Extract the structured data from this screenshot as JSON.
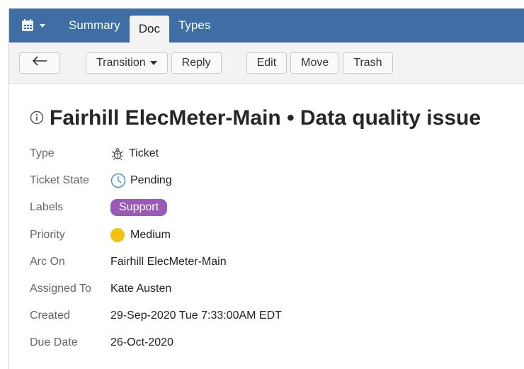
{
  "nav": {
    "tabs": [
      {
        "label": "Summary",
        "active": false
      },
      {
        "label": "Doc",
        "active": true
      },
      {
        "label": "Types",
        "active": false
      }
    ],
    "app_menu_icon": "calendar-icon"
  },
  "toolbar": {
    "back_icon": "arrow-left-icon",
    "transition_label": "Transition",
    "reply_label": "Reply",
    "edit_label": "Edit",
    "move_label": "Move",
    "trash_label": "Trash"
  },
  "doc": {
    "title": "Fairhill ElecMeter-Main • Data quality issue",
    "fields": {
      "type": {
        "label": "Type",
        "value": "Ticket",
        "icon": "bug-icon"
      },
      "ticket_state": {
        "label": "Ticket State",
        "value": "Pending",
        "icon": "clock-icon"
      },
      "labels": {
        "label": "Labels",
        "value": "Support",
        "color": "#9b59b6"
      },
      "priority": {
        "label": "Priority",
        "value": "Medium",
        "color": "#f2c20f"
      },
      "arc_on": {
        "label": "Arc On",
        "value": "Fairhill ElecMeter-Main"
      },
      "assigned_to": {
        "label": "Assigned To",
        "value": "Kate Austen"
      },
      "created": {
        "label": "Created",
        "value": "29-Sep-2020 Tue 7:33:00AM EDT"
      },
      "due_date": {
        "label": "Due Date",
        "value": "26-Oct-2020"
      }
    }
  },
  "colors": {
    "topbar": "#3e6ea3",
    "toolbar_bg": "#f3f3f3",
    "clock": "#4a90d9"
  }
}
